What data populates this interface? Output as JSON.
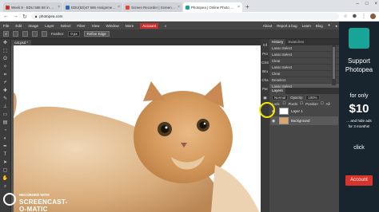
{
  "browser": {
    "tabs": [
      {
        "title": "Week 8 - EDU 586 5S in Spo",
        "color": "#c0392b",
        "active": false
      },
      {
        "title": "EDU(5S)47 586 Assignment W",
        "color": "#2a6ab3",
        "active": false
      },
      {
        "title": "Screen Recorder | Screencast-O",
        "color": "#e2462f",
        "active": false
      },
      {
        "title": "Photopea | Online Photo Editor",
        "color": "#18a497",
        "active": true
      }
    ],
    "new_tab": "+",
    "url": "photopea.com"
  },
  "menu": {
    "items": [
      "File",
      "Edit",
      "Image",
      "Layer",
      "Select",
      "Filter",
      "View",
      "Window",
      "More"
    ],
    "account": "Account",
    "right_items": [
      "About",
      "Report a bug",
      "Learn",
      "Blog"
    ]
  },
  "options": {
    "feather_label": "Feather:",
    "feather_value": "0 px",
    "refine_label": "Refine Edge"
  },
  "document": {
    "tab_title": "cat.psd *"
  },
  "side_panel": {
    "items": [
      "Inf",
      "Pro",
      "CSS",
      "Bru",
      "Cha",
      "Par"
    ]
  },
  "history": {
    "tabs": [
      "History",
      "Swatches"
    ],
    "rows": [
      "Lasso Select",
      "Lasso Select",
      "Clear",
      "Lasso Select",
      "Clear",
      "Deselect",
      "Lasso Select"
    ]
  },
  "layers": {
    "tab": "Layers",
    "blend_mode": "Normal",
    "opacity_label": "Opacity:",
    "opacity_value": "100%",
    "lock_label": "Lock:",
    "lock_options": [
      "Pixels",
      "Position",
      "All"
    ],
    "items": [
      {
        "name": "Layer 1"
      },
      {
        "name": "Background"
      }
    ]
  },
  "ad": {
    "line1": "Support",
    "line2": "Photopea",
    "line3": "for only",
    "price": "$10",
    "line4": "... and hide ads",
    "line5": "for 3 months!",
    "click": "click",
    "button": "Account"
  },
  "watermark": {
    "line1": "RECORDED WITH",
    "line2": "SCREENCAST-O-MATIC"
  },
  "colors": {
    "accent_red": "#c62f2f",
    "photopea_teal": "#18a497",
    "panel_bg": "#474747"
  }
}
